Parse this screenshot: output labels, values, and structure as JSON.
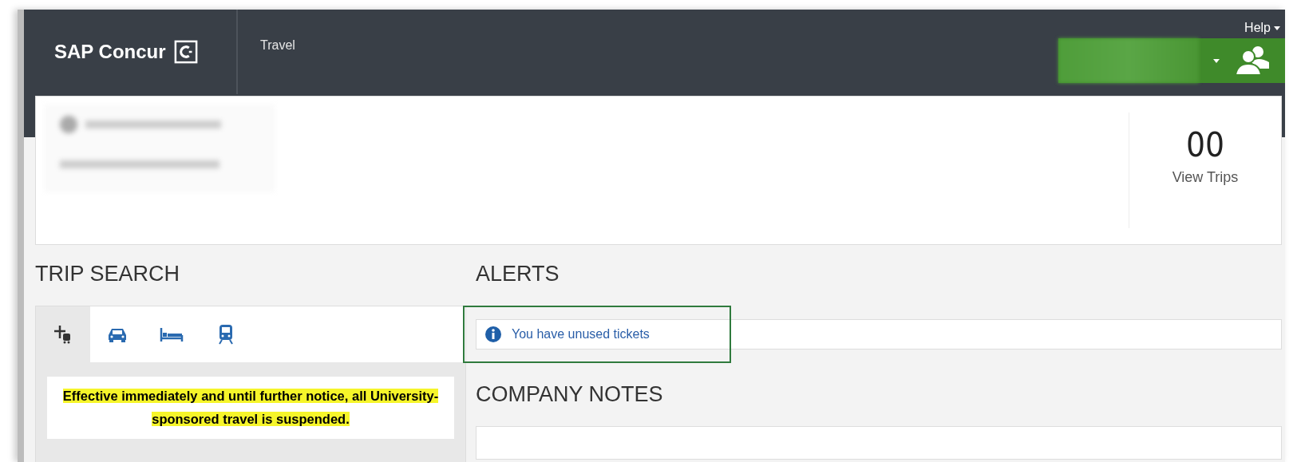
{
  "header": {
    "logo": "SAP Concur",
    "nav": [
      {
        "label": "Travel",
        "selected": false
      }
    ],
    "help": "Help"
  },
  "trips": {
    "count": "00",
    "label": "View Trips"
  },
  "trip_search": {
    "title": "TRIP SEARCH",
    "tabs": [
      {
        "kind": "flight",
        "selected": true
      },
      {
        "kind": "car",
        "selected": false
      },
      {
        "kind": "hotel",
        "selected": false
      },
      {
        "kind": "rail",
        "selected": false
      }
    ],
    "notice": "Effective immediately and until further notice, all University-sponsored travel is suspended."
  },
  "alerts": {
    "title": "ALERTS",
    "items": [
      {
        "text": "You have unused tickets",
        "highlighted": true
      }
    ]
  },
  "company_notes": {
    "title": "COMPANY NOTES"
  }
}
